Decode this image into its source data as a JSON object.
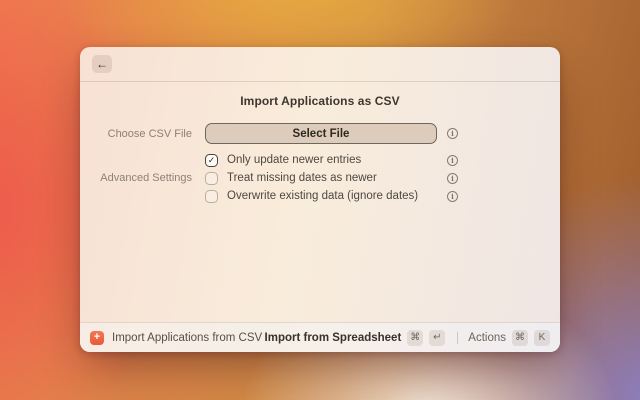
{
  "icons": {
    "back": "←",
    "info": "i",
    "check": "✓",
    "plus": "+"
  },
  "window": {
    "title": "Import Applications as CSV",
    "form": {
      "file_row": {
        "label": "Choose CSV File",
        "button_label": "Select File"
      },
      "advanced_label": "Advanced Settings",
      "checkboxes": [
        {
          "label": "Only update newer entries",
          "checked": true
        },
        {
          "label": "Treat missing dates as newer",
          "checked": false
        },
        {
          "label": "Overwrite existing data (ignore dates)",
          "checked": false
        }
      ]
    },
    "footer": {
      "app_name": "Import Applications from CSV",
      "primary_action": {
        "label": "Import from Spreadsheet",
        "keys": [
          "⌘",
          "↵"
        ]
      },
      "actions_menu": {
        "label": "Actions",
        "keys": [
          "⌘",
          "K"
        ]
      }
    },
    "colors": {
      "accent_orange": "#f26b4a",
      "background_red": "#ee564b",
      "background_gold": "#ebb33e",
      "background_purple": "#8b80c6",
      "window_background": "#f8e9db"
    }
  }
}
